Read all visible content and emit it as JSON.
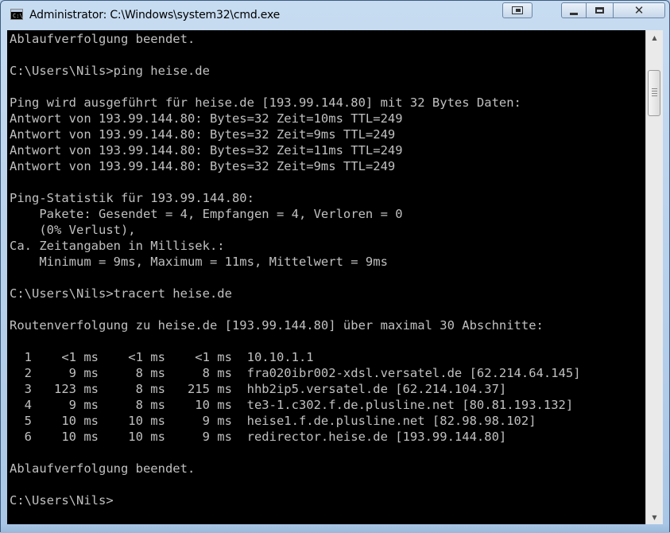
{
  "window": {
    "title": "Administrator: C:\\Windows\\system32\\cmd.exe",
    "app_icon_text": "C:\\"
  },
  "console": {
    "lines": [
      "Ablaufverfolgung beendet.",
      "",
      "C:\\Users\\Nils>ping heise.de",
      "",
      "Ping wird ausgeführt für heise.de [193.99.144.80] mit 32 Bytes Daten:",
      "Antwort von 193.99.144.80: Bytes=32 Zeit=10ms TTL=249",
      "Antwort von 193.99.144.80: Bytes=32 Zeit=9ms TTL=249",
      "Antwort von 193.99.144.80: Bytes=32 Zeit=11ms TTL=249",
      "Antwort von 193.99.144.80: Bytes=32 Zeit=9ms TTL=249",
      "",
      "Ping-Statistik für 193.99.144.80:",
      "    Pakete: Gesendet = 4, Empfangen = 4, Verloren = 0",
      "    (0% Verlust),",
      "Ca. Zeitangaben in Millisek.:",
      "    Minimum = 9ms, Maximum = 11ms, Mittelwert = 9ms",
      "",
      "C:\\Users\\Nils>tracert heise.de",
      "",
      "Routenverfolgung zu heise.de [193.99.144.80] über maximal 30 Abschnitte:",
      "",
      "  1    <1 ms    <1 ms    <1 ms  10.10.1.1",
      "  2     9 ms     8 ms     8 ms  fra020ibr002-xdsl.versatel.de [62.214.64.145]",
      "  3   123 ms     8 ms   215 ms  hhb2ip5.versatel.de [62.214.104.37]",
      "  4     9 ms     8 ms    10 ms  te3-1.c302.f.de.plusline.net [80.81.193.132]",
      "  5    10 ms    10 ms     9 ms  heise1.f.de.plusline.net [82.98.98.102]",
      "  6    10 ms    10 ms     9 ms  redirector.heise.de [193.99.144.80]",
      "",
      "Ablaufverfolgung beendet.",
      "",
      "C:\\Users\\Nils>"
    ]
  },
  "colors": {
    "console_bg": "#000000",
    "console_fg": "#c0c0c0",
    "titlebar": "#c7dcf1"
  },
  "icons": {
    "minimize": "minimize-icon",
    "maximize": "maximize-icon",
    "close": "close-icon",
    "restore": "restore-icon",
    "app": "cmd-icon"
  }
}
